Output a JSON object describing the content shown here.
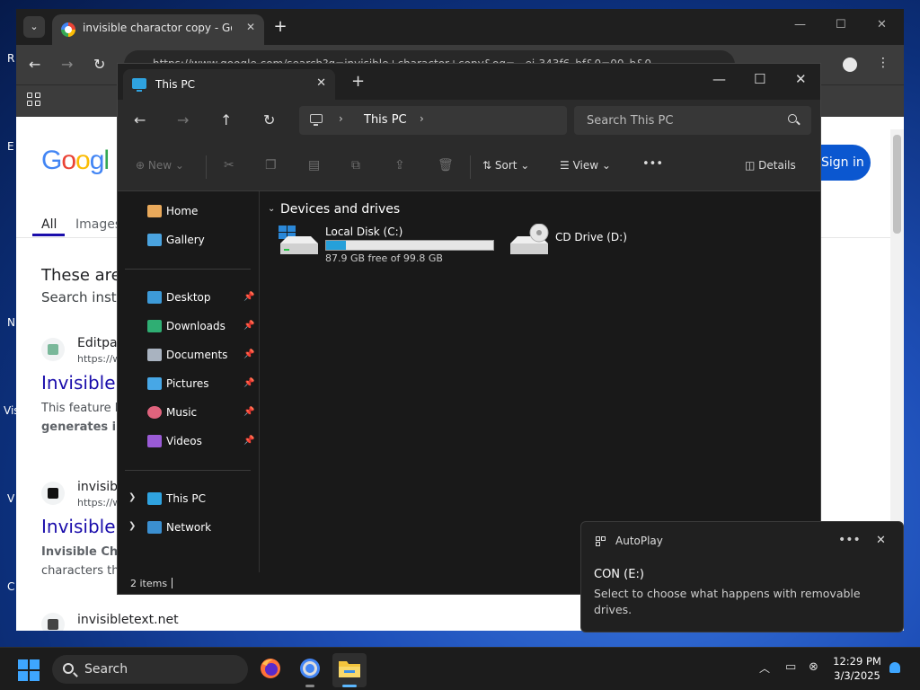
{
  "desktop": {
    "edge_letters": [
      "R",
      "E",
      "N",
      "Vis",
      "V",
      "C"
    ]
  },
  "chrome": {
    "tab_title": "invisible charactor copy - Goog",
    "url": "https://www.google.com/search?q=invisible+charactor+copy&oq=...ei-343f6_bf&0=00_b&0...",
    "accent": "#0b57d0"
  },
  "google": {
    "logo": "Google",
    "sign_in": "Sign in",
    "tabs": [
      "All",
      "Images"
    ],
    "notice": "These are",
    "notice_sub": "Search inste",
    "results": [
      {
        "site": "Editpad",
        "url": "https://w",
        "title": "Invisible C",
        "snippet": "This feature h",
        "snippet_bold": "generates in"
      },
      {
        "site": "invisible",
        "url": "https://w",
        "title": "Invisible C",
        "snippet": "Invisible Cha",
        "snippet2": "characters thr"
      },
      {
        "site": "invisibletext.net"
      }
    ]
  },
  "explorer": {
    "tab_title": "This PC",
    "address": "This PC",
    "search_placeholder": "Search This PC",
    "commands": {
      "new": "New",
      "sort": "Sort",
      "view": "View",
      "more": "•••",
      "details": "Details"
    },
    "sidebar": {
      "top": [
        "Home",
        "Gallery"
      ],
      "pinned": [
        "Desktop",
        "Downloads",
        "Documents",
        "Pictures",
        "Music",
        "Videos"
      ],
      "tree": [
        "This PC",
        "Network"
      ]
    },
    "section_title": "Devices and drives",
    "drives": [
      {
        "name": "Local Disk (C:)",
        "free_text": "87.9 GB free of 99.8 GB",
        "used_fraction": 0.12
      },
      {
        "name": "CD Drive (D:)"
      }
    ],
    "status": "2 items"
  },
  "autoplay": {
    "title": "AutoPlay",
    "more": "•••",
    "drive": "CON (E:)",
    "message": "Select to choose what happens with removable drives."
  },
  "taskbar": {
    "search_label": "Search",
    "time": "12:29 PM",
    "date": "3/3/2025"
  }
}
